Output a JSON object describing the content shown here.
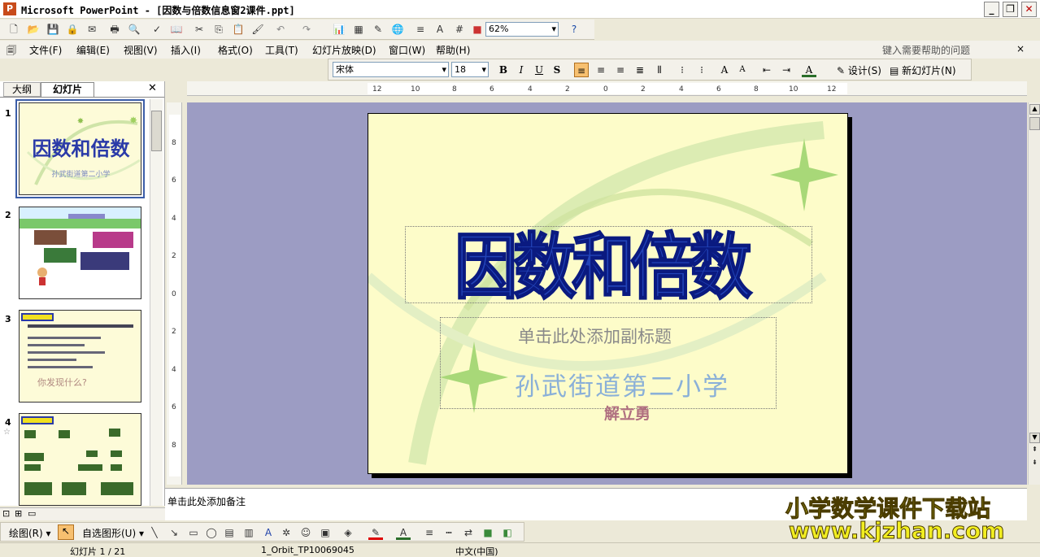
{
  "window": {
    "title": "Microsoft PowerPoint - [因数与倍数信息窗2课件.ppt]"
  },
  "toolbar": {
    "zoom": "62%"
  },
  "menu": {
    "items": [
      "文件(F)",
      "编辑(E)",
      "视图(V)",
      "插入(I)",
      "格式(O)",
      "工具(T)",
      "幻灯片放映(D)",
      "窗口(W)",
      "帮助(H)"
    ],
    "help_placeholder": "键入需要帮助的问题"
  },
  "format": {
    "font": "宋体",
    "size": "18",
    "design_label": "设计(S)",
    "new_slide_label": "新幻灯片(N)"
  },
  "panel": {
    "tab_outline": "大纲",
    "tab_slides": "幻灯片"
  },
  "thumbnails": [
    {
      "num": "1",
      "title": "因数和倍数",
      "text": "孙武街道第二小学"
    },
    {
      "num": "2",
      "title": "",
      "text": ""
    },
    {
      "num": "3",
      "title": "",
      "text": "你发现什么?"
    },
    {
      "num": "4",
      "title": "",
      "text": ""
    }
  ],
  "slide": {
    "title": "因数和倍数",
    "subtitle_placeholder": "单击此处添加副标题",
    "school": "孙武街道第二小学",
    "author": "解立勇"
  },
  "notes": {
    "placeholder": "单击此处添加备注"
  },
  "draw": {
    "draw_label": "绘图(R)",
    "autoshape_label": "自选图形(U)"
  },
  "status": {
    "slide": "幻灯片 1 / 21",
    "design": "1_Orbit_TP10069045",
    "language": "中文(中国)"
  },
  "watermark": {
    "line1": "小学数学课件下载站",
    "line2": "www.kjzhan.com"
  }
}
